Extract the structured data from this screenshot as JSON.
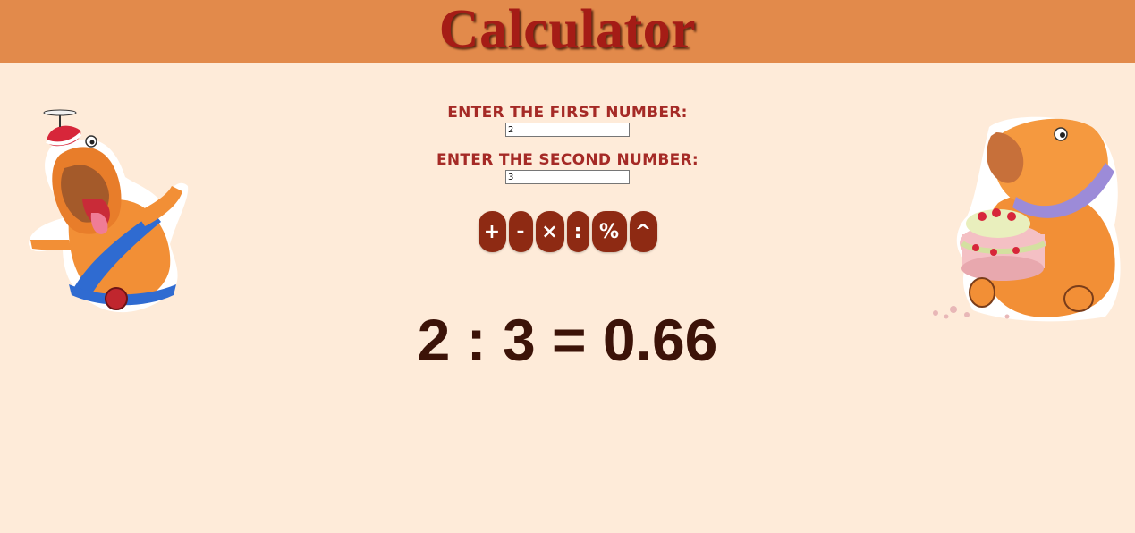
{
  "header": {
    "title": "Calculator"
  },
  "form": {
    "first_label": "ENTER THE FIRST NUMBER:",
    "first_value": "2",
    "second_label": "ENTER THE SECOND NUMBER:",
    "second_value": "3"
  },
  "operations": [
    {
      "id": "add",
      "label": "+"
    },
    {
      "id": "subtract",
      "label": "-"
    },
    {
      "id": "multiply",
      "label": "×"
    },
    {
      "id": "divide",
      "label": ":"
    },
    {
      "id": "percent",
      "label": "%"
    },
    {
      "id": "power",
      "label": "^"
    }
  ],
  "result": {
    "text": "2 : 3 = 0.66"
  },
  "illustrations": {
    "left": "capybara-propeller-hat-sticker",
    "right": "capybara-cake-sticker"
  },
  "colors": {
    "header_bg": "#e28a4b",
    "page_bg": "#feebd9",
    "title": "#a51c16",
    "label": "#a52a26",
    "button_bg": "#8e2a13",
    "result": "#3c1308"
  }
}
